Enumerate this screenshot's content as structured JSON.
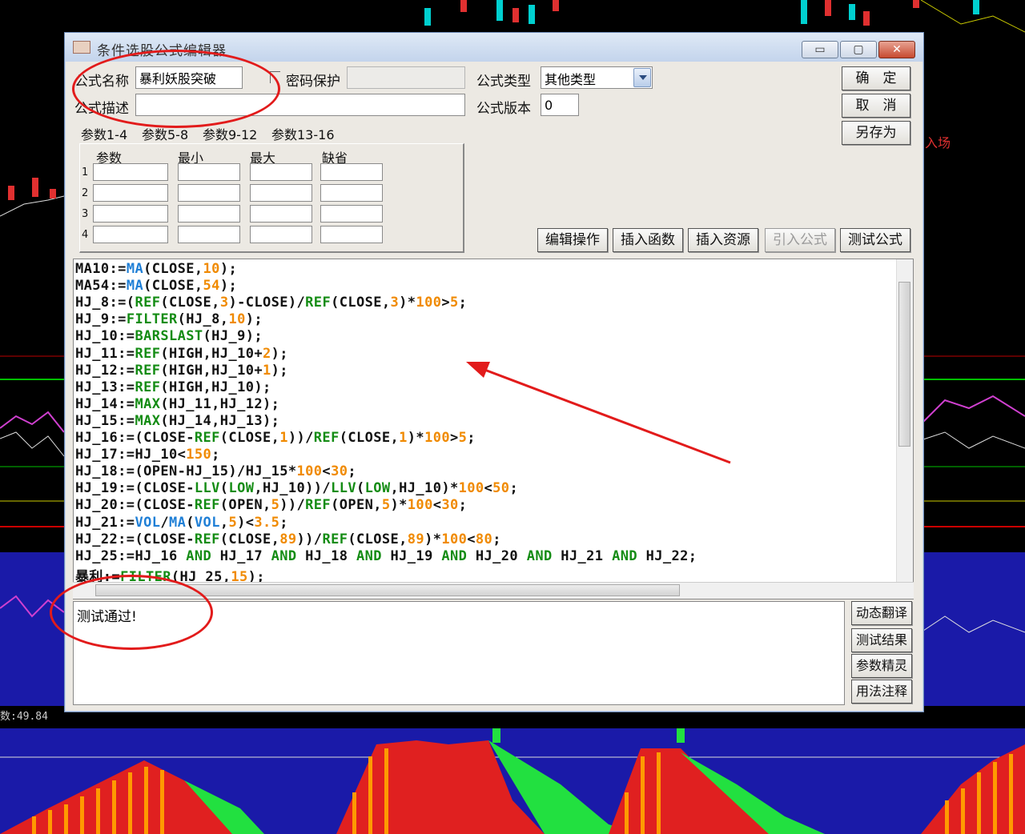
{
  "dialog": {
    "title": "条件选股公式编辑器",
    "window_buttons": {
      "minimize": "▭",
      "maximize": "▢",
      "close": "✕"
    }
  },
  "form": {
    "name_label": "公式名称",
    "name_value": "暴利妖股突破",
    "password_label": "密码保护",
    "type_label": "公式类型",
    "type_value": "其他类型",
    "desc_label": "公式描述",
    "desc_value": "",
    "version_label": "公式版本",
    "version_value": "0"
  },
  "right_buttons": {
    "ok": "确　定",
    "cancel": "取　消",
    "save_as": "另存为"
  },
  "tabs": [
    "参数1-4",
    "参数5-8",
    "参数9-12",
    "参数13-16"
  ],
  "param_grid": {
    "headers": [
      "参数",
      "最小",
      "最大",
      "缺省"
    ],
    "rows": [
      "1",
      "2",
      "3",
      "4"
    ]
  },
  "toolbar": [
    "编辑操作",
    "插入函数",
    "插入资源",
    "引入公式",
    "测试公式"
  ],
  "code_lines": [
    [
      [
        "MA10:=",
        "k"
      ],
      [
        "MA",
        "b"
      ],
      [
        "(CLOSE,",
        "k"
      ],
      [
        "10",
        "o"
      ],
      [
        ");",
        "k"
      ]
    ],
    [
      [
        "MA54:=",
        "k"
      ],
      [
        "MA",
        "b"
      ],
      [
        "(CLOSE,",
        "k"
      ],
      [
        "54",
        "o"
      ],
      [
        ");",
        "k"
      ]
    ],
    [
      [
        "HJ_8:=(",
        "k"
      ],
      [
        "REF",
        "g"
      ],
      [
        "(CLOSE,",
        "k"
      ],
      [
        "3",
        "o"
      ],
      [
        ")-CLOSE)/",
        "k"
      ],
      [
        "REF",
        "g"
      ],
      [
        "(CLOSE,",
        "k"
      ],
      [
        "3",
        "o"
      ],
      [
        ")*",
        "k"
      ],
      [
        "100",
        "o"
      ],
      [
        ">",
        "k"
      ],
      [
        "5",
        "o"
      ],
      [
        ";",
        "k"
      ]
    ],
    [
      [
        "HJ_9:=",
        "k"
      ],
      [
        "FILTER",
        "g"
      ],
      [
        "(HJ_8,",
        "k"
      ],
      [
        "10",
        "o"
      ],
      [
        ");",
        "k"
      ]
    ],
    [
      [
        "HJ_10:=",
        "k"
      ],
      [
        "BARSLAST",
        "g"
      ],
      [
        "(HJ_9);",
        "k"
      ]
    ],
    [
      [
        "HJ_11:=",
        "k"
      ],
      [
        "REF",
        "g"
      ],
      [
        "(HIGH,HJ_10+",
        "k"
      ],
      [
        "2",
        "o"
      ],
      [
        ");",
        "k"
      ]
    ],
    [
      [
        "HJ_12:=",
        "k"
      ],
      [
        "REF",
        "g"
      ],
      [
        "(HIGH,HJ_10+",
        "k"
      ],
      [
        "1",
        "o"
      ],
      [
        ");",
        "k"
      ]
    ],
    [
      [
        "HJ_13:=",
        "k"
      ],
      [
        "REF",
        "g"
      ],
      [
        "(HIGH,HJ_10);",
        "k"
      ]
    ],
    [
      [
        "HJ_14:=",
        "k"
      ],
      [
        "MAX",
        "g"
      ],
      [
        "(HJ_11,HJ_12);",
        "k"
      ]
    ],
    [
      [
        "HJ_15:=",
        "k"
      ],
      [
        "MAX",
        "g"
      ],
      [
        "(HJ_14,HJ_13);",
        "k"
      ]
    ],
    [
      [
        "HJ_16:=(CLOSE-",
        "k"
      ],
      [
        "REF",
        "g"
      ],
      [
        "(CLOSE,",
        "k"
      ],
      [
        "1",
        "o"
      ],
      [
        "))/",
        "k"
      ],
      [
        "REF",
        "g"
      ],
      [
        "(CLOSE,",
        "k"
      ],
      [
        "1",
        "o"
      ],
      [
        ")*",
        "k"
      ],
      [
        "100",
        "o"
      ],
      [
        ">",
        "k"
      ],
      [
        "5",
        "o"
      ],
      [
        ";",
        "k"
      ]
    ],
    [
      [
        "HJ_17:=HJ_10<",
        "k"
      ],
      [
        "150",
        "o"
      ],
      [
        ";",
        "k"
      ]
    ],
    [
      [
        "HJ_18:=(OPEN-HJ_15)/HJ_15*",
        "k"
      ],
      [
        "100",
        "o"
      ],
      [
        "<",
        "k"
      ],
      [
        "30",
        "o"
      ],
      [
        ";",
        "k"
      ]
    ],
    [
      [
        "HJ_19:=(CLOSE-",
        "k"
      ],
      [
        "LLV",
        "g"
      ],
      [
        "(",
        "k"
      ],
      [
        "LOW",
        "g"
      ],
      [
        ",HJ_10))/",
        "k"
      ],
      [
        "LLV",
        "g"
      ],
      [
        "(",
        "k"
      ],
      [
        "LOW",
        "g"
      ],
      [
        ",HJ_10)*",
        "k"
      ],
      [
        "100",
        "o"
      ],
      [
        "<",
        "k"
      ],
      [
        "50",
        "o"
      ],
      [
        ";",
        "k"
      ]
    ],
    [
      [
        "HJ_20:=(CLOSE-",
        "k"
      ],
      [
        "REF",
        "g"
      ],
      [
        "(OPEN,",
        "k"
      ],
      [
        "5",
        "o"
      ],
      [
        "))/",
        "k"
      ],
      [
        "REF",
        "g"
      ],
      [
        "(OPEN,",
        "k"
      ],
      [
        "5",
        "o"
      ],
      [
        ")*",
        "k"
      ],
      [
        "100",
        "o"
      ],
      [
        "<",
        "k"
      ],
      [
        "30",
        "o"
      ],
      [
        ";",
        "k"
      ]
    ],
    [
      [
        "HJ_21:=",
        "k"
      ],
      [
        "VOL",
        "b"
      ],
      [
        "/",
        "k"
      ],
      [
        "MA",
        "b"
      ],
      [
        "(",
        "k"
      ],
      [
        "VOL",
        "b"
      ],
      [
        ",",
        "k"
      ],
      [
        "5",
        "o"
      ],
      [
        ")<",
        "k"
      ],
      [
        "3.5",
        "o"
      ],
      [
        ";",
        "k"
      ]
    ],
    [
      [
        "HJ_22:=(CLOSE-",
        "k"
      ],
      [
        "REF",
        "g"
      ],
      [
        "(CLOSE,",
        "k"
      ],
      [
        "89",
        "o"
      ],
      [
        "))/",
        "k"
      ],
      [
        "REF",
        "g"
      ],
      [
        "(CLOSE,",
        "k"
      ],
      [
        "89",
        "o"
      ],
      [
        ")*",
        "k"
      ],
      [
        "100",
        "o"
      ],
      [
        "<",
        "k"
      ],
      [
        "80",
        "o"
      ],
      [
        ";",
        "k"
      ]
    ],
    [
      [
        "HJ_25:=HJ_16 ",
        "k"
      ],
      [
        "AND",
        "g"
      ],
      [
        " HJ_17 ",
        "k"
      ],
      [
        "AND",
        "g"
      ],
      [
        " HJ_18 ",
        "k"
      ],
      [
        "AND",
        "g"
      ],
      [
        " HJ_19 ",
        "k"
      ],
      [
        "AND",
        "g"
      ],
      [
        " HJ_20 ",
        "k"
      ],
      [
        "AND",
        "g"
      ],
      [
        " HJ_21 ",
        "k"
      ],
      [
        "AND",
        "g"
      ],
      [
        " HJ_22;",
        "k"
      ]
    ],
    [
      [
        "暴利:=",
        "k"
      ],
      [
        "FILTER",
        "g"
      ],
      [
        "(HJ_25,",
        "k"
      ],
      [
        "15",
        "o"
      ],
      [
        ");",
        "k"
      ]
    ]
  ],
  "message": "测试通过!",
  "side_buttons": [
    "动态翻译",
    "测试结果",
    "参数精灵",
    "用法注释"
  ],
  "background": {
    "readout": "49.84",
    "text_ru_chang": "入场"
  },
  "colors": {
    "keyword_green": "#148c14",
    "function_blue": "#1f7fd6",
    "number_orange": "#f08a00",
    "annotation_red": "#e21b1b"
  }
}
